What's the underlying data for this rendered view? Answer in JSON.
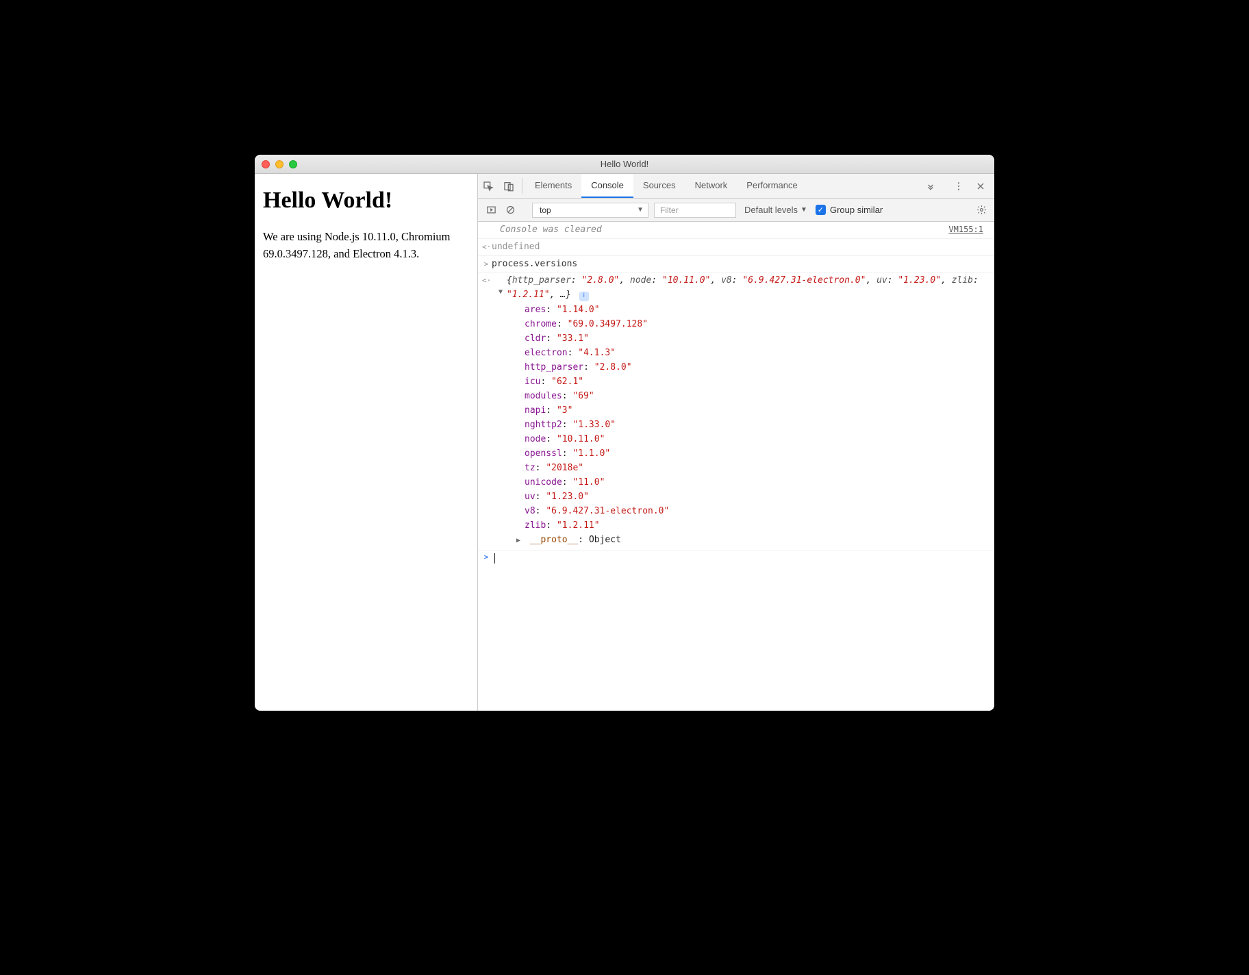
{
  "window": {
    "title": "Hello World!"
  },
  "page": {
    "heading": "Hello World!",
    "paragraph": "We are using Node.js 10.11.0, Chromium 69.0.3497.128, and Electron 4.1.3."
  },
  "devtools": {
    "tabs": {
      "elements": "Elements",
      "console": "Console",
      "sources": "Sources",
      "network": "Network",
      "performance": "Performance"
    },
    "toolbar": {
      "context": "top",
      "filter_placeholder": "Filter",
      "levels": "Default levels",
      "group_similar": "Group similar"
    },
    "console": {
      "cleared_msg": "Console was cleared",
      "vm_link": "VM155:1",
      "undefined_label": "undefined",
      "input_expr": "process.versions",
      "summary_display": "{http_parser: \"2.8.0\", node: \"10.11.0\", v8: \"6.9.427.31-electron.0\", uv: \"1.23.0\", zlib: \"1.2.11\", …}",
      "props": [
        {
          "k": "ares",
          "v": "\"1.14.0\""
        },
        {
          "k": "chrome",
          "v": "\"69.0.3497.128\""
        },
        {
          "k": "cldr",
          "v": "\"33.1\""
        },
        {
          "k": "electron",
          "v": "\"4.1.3\""
        },
        {
          "k": "http_parser",
          "v": "\"2.8.0\""
        },
        {
          "k": "icu",
          "v": "\"62.1\""
        },
        {
          "k": "modules",
          "v": "\"69\""
        },
        {
          "k": "napi",
          "v": "\"3\""
        },
        {
          "k": "nghttp2",
          "v": "\"1.33.0\""
        },
        {
          "k": "node",
          "v": "\"10.11.0\""
        },
        {
          "k": "openssl",
          "v": "\"1.1.0\""
        },
        {
          "k": "tz",
          "v": "\"2018e\""
        },
        {
          "k": "unicode",
          "v": "\"11.0\""
        },
        {
          "k": "uv",
          "v": "\"1.23.0\""
        },
        {
          "k": "v8",
          "v": "\"6.9.427.31-electron.0\""
        },
        {
          "k": "zlib",
          "v": "\"1.2.11\""
        }
      ],
      "proto_key": "__proto__",
      "proto_val": "Object"
    }
  }
}
